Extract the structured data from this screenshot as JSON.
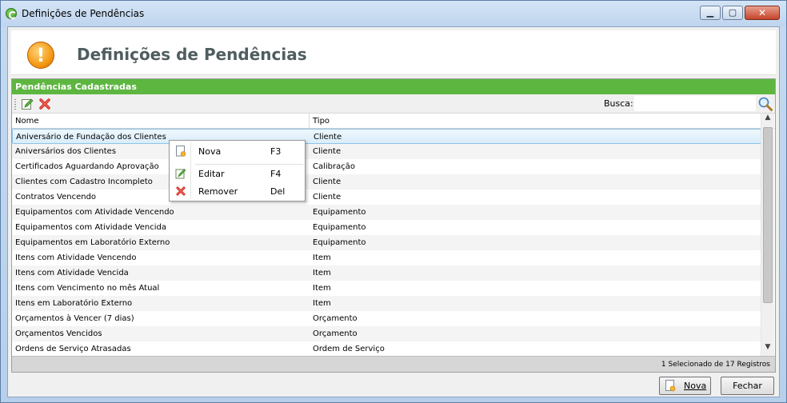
{
  "window": {
    "title": "Definições de Pendências"
  },
  "header": {
    "title": "Definições de Pendências"
  },
  "panel": {
    "title": "Pendências Cadastradas",
    "search_label": "Busca:",
    "search_value": ""
  },
  "grid": {
    "columns": [
      "Nome",
      "Tipo"
    ],
    "rows": [
      {
        "nome": "Aniversário de Fundação dos Clientes",
        "tipo": "Cliente"
      },
      {
        "nome": "Aniversários dos Clientes",
        "tipo": "Cliente"
      },
      {
        "nome": "Certificados Aguardando Aprovação",
        "tipo": "Calibração"
      },
      {
        "nome": "Clientes com Cadastro Incompleto",
        "tipo": "Cliente"
      },
      {
        "nome": "Contratos Vencendo",
        "tipo": "Cliente"
      },
      {
        "nome": "Equipamentos com Atividade Vencendo",
        "tipo": "Equipamento"
      },
      {
        "nome": "Equipamentos com Atividade Vencida",
        "tipo": "Equipamento"
      },
      {
        "nome": "Equipamentos em Laboratório Externo",
        "tipo": "Equipamento"
      },
      {
        "nome": "Itens com Atividade Vencendo",
        "tipo": "Item"
      },
      {
        "nome": "Itens com Atividade Vencida",
        "tipo": "Item"
      },
      {
        "nome": "Itens com Vencimento no mês Atual",
        "tipo": "Item"
      },
      {
        "nome": "Itens em Laboratório Externo",
        "tipo": "Item"
      },
      {
        "nome": "Orçamentos à Vencer (7 dias)",
        "tipo": "Orçamento"
      },
      {
        "nome": "Orçamentos Vencidos",
        "tipo": "Orçamento"
      },
      {
        "nome": "Ordens de Serviço Atrasadas",
        "tipo": "Ordem de Serviço"
      }
    ],
    "selected_index": 0,
    "status": "1 Selecionado de 17 Registros"
  },
  "context_menu": {
    "items": [
      {
        "label": "Nova",
        "shortcut": "F3",
        "icon": "new-document-icon"
      },
      {
        "label": "Editar",
        "shortcut": "F4",
        "icon": "edit-icon"
      },
      {
        "label": "Remover",
        "shortcut": "Del",
        "icon": "remove-icon"
      }
    ]
  },
  "buttons": {
    "nova": "Nova",
    "fechar": "Fechar"
  },
  "colors": {
    "panel_header": "#5db640",
    "title_text": "#4f5d5f",
    "warning": "#f39a14"
  }
}
